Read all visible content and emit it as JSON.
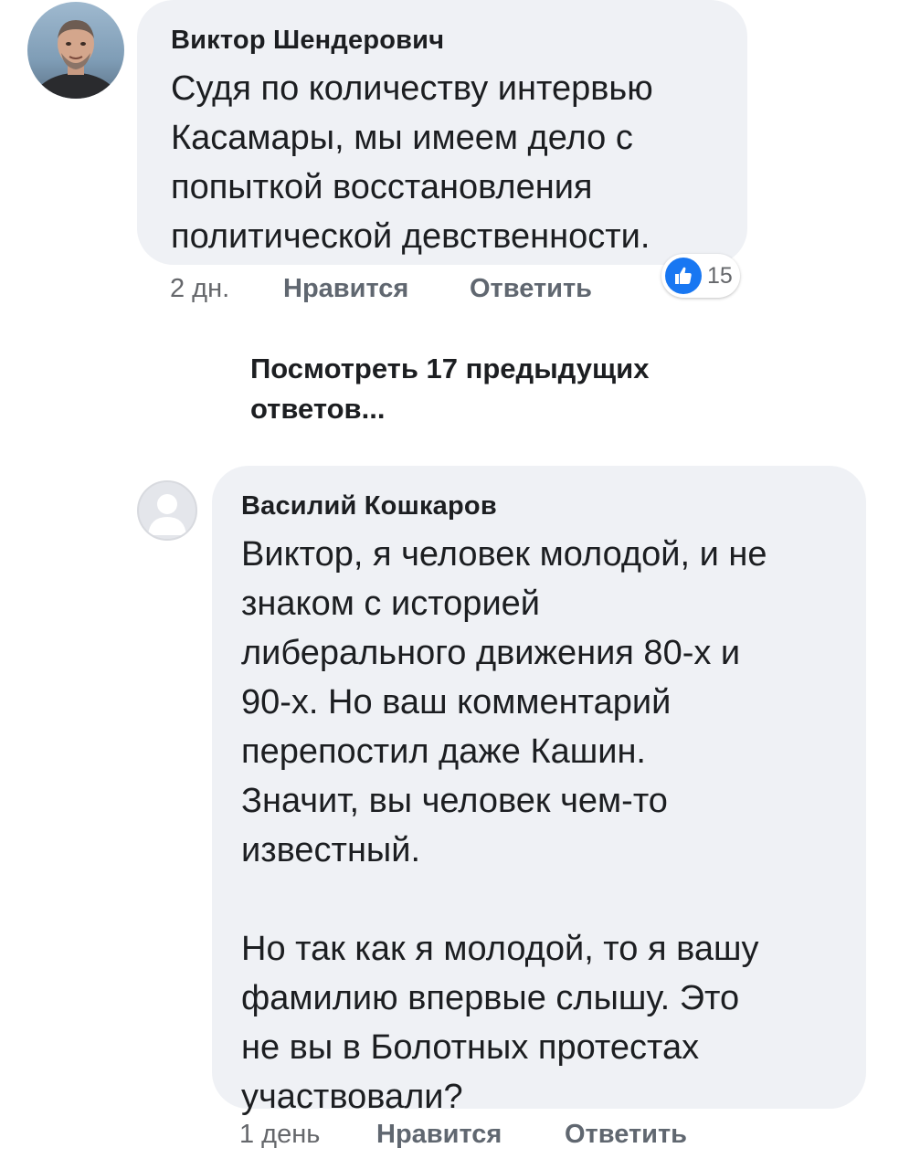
{
  "comments": [
    {
      "author": "Виктор Шендерович",
      "text": "Судя по количеству интервью\nКасамары, мы имеем дело с\nпопыткой восстановления\nполитической девственности.",
      "time": "2 дн.",
      "like_label": "Нравится",
      "reply_label": "Ответить",
      "reactions": {
        "icon": "thumbs-up-icon",
        "count": "15",
        "color": "#1877f2"
      }
    },
    {
      "author": "Василий Кошкаров",
      "text": "Виктор, я человек молодой, и не\nзнаком с историей\nлиберального движения 80-х и\n90-х. Но ваш комментарий\nперепостил даже Кашин.\nЗначит, вы человек чем-то\nизвестный.\n\nНо так как я молодой, то я вашу\nфамилию впервые слышу. Это\nне вы в Болотных протестах\nучаствовали?",
      "time": "1 день",
      "like_label": "Нравится",
      "reply_label": "Ответить"
    }
  ],
  "more_replies_label": "Посмотреть 17 предыдущих ответов..."
}
